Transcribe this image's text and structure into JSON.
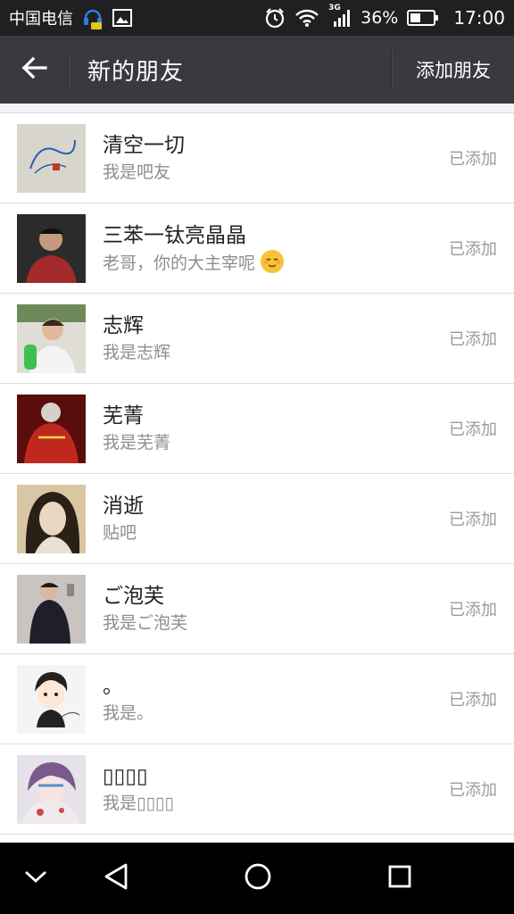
{
  "status_bar": {
    "carrier": "中国电信",
    "battery": "36%",
    "time": "17:00",
    "network_badge": "3G",
    "icons": [
      "headset-icon",
      "image-icon",
      "alarm-icon",
      "wifi-icon",
      "signal-icon",
      "battery-icon"
    ]
  },
  "header": {
    "title": "新的朋友",
    "action": "添加朋友",
    "back_icon": "arrow-left-icon"
  },
  "friends": [
    {
      "name": "清空一切",
      "message": "我是吧友",
      "status": "已添加",
      "avatar_colors": [
        "#d8d6cc",
        "#2a5db0"
      ]
    },
    {
      "name": "三苯一钛亮晶晶",
      "message": "老哥，你的大主宰呢",
      "status": "已添加",
      "emoji": "relieved-face-icon",
      "avatar_colors": [
        "#2b2b2b",
        "#a32a2a"
      ]
    },
    {
      "name": "志辉",
      "message": "我是志辉",
      "status": "已添加",
      "avatar_colors": [
        "#e0ddd6",
        "#3fbf4f"
      ]
    },
    {
      "name": "芜菁",
      "message": "我是芜菁",
      "status": "已添加",
      "avatar_colors": [
        "#5a0d0d",
        "#c0281e"
      ]
    },
    {
      "name": "消逝",
      "message": "贴吧",
      "status": "已添加",
      "avatar_colors": [
        "#d9c7a4",
        "#2b2018"
      ]
    },
    {
      "name": "ご泡芙",
      "message": "我是ご泡芙",
      "status": "已添加",
      "avatar_colors": [
        "#c9c4c0",
        "#1e1f2a"
      ]
    },
    {
      "name": "。",
      "message": "我是。",
      "status": "已添加",
      "avatar_colors": [
        "#f4f4f4",
        "#222222"
      ]
    },
    {
      "name": "▯▯▯▯",
      "message": "我是▯▯▯▯",
      "status": "已添加",
      "avatar_colors": [
        "#e6e2ea",
        "#7a5a8c"
      ]
    }
  ],
  "nav": {
    "icons": [
      "chevron-down-icon",
      "back-triangle-icon",
      "home-circle-icon",
      "recents-square-icon"
    ]
  },
  "colors": {
    "status_bar_bg": "#1f2022",
    "title_bar_bg": "#393a3f",
    "secondary_text": "#8e8e8e",
    "nav_bar_bg": "#000000"
  }
}
